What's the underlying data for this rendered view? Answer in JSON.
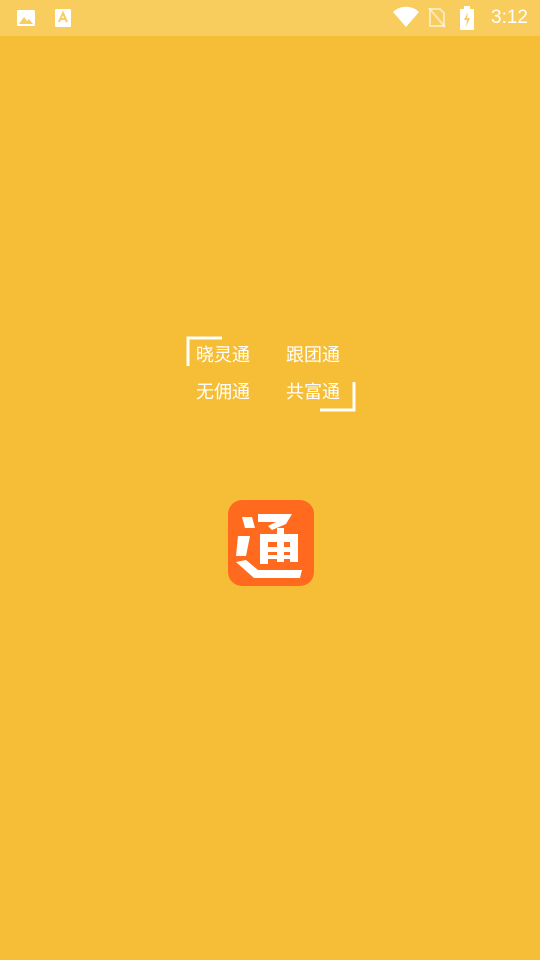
{
  "status_bar": {
    "left_icons": [
      "image-icon",
      "download-icon"
    ],
    "right_icons": [
      "wifi-icon",
      "no-sim-icon",
      "battery-charging-icon"
    ],
    "time": "3:12"
  },
  "splash": {
    "words": [
      "晓灵通",
      "跟团通",
      "无佣通",
      "共富通"
    ]
  },
  "logo": {
    "icon": "tong-logo-icon"
  },
  "colors": {
    "background": "#F6BE36",
    "status_bar": "#F8CD5E",
    "logo": "#FF6A1F",
    "text": "#FFFFFF"
  }
}
